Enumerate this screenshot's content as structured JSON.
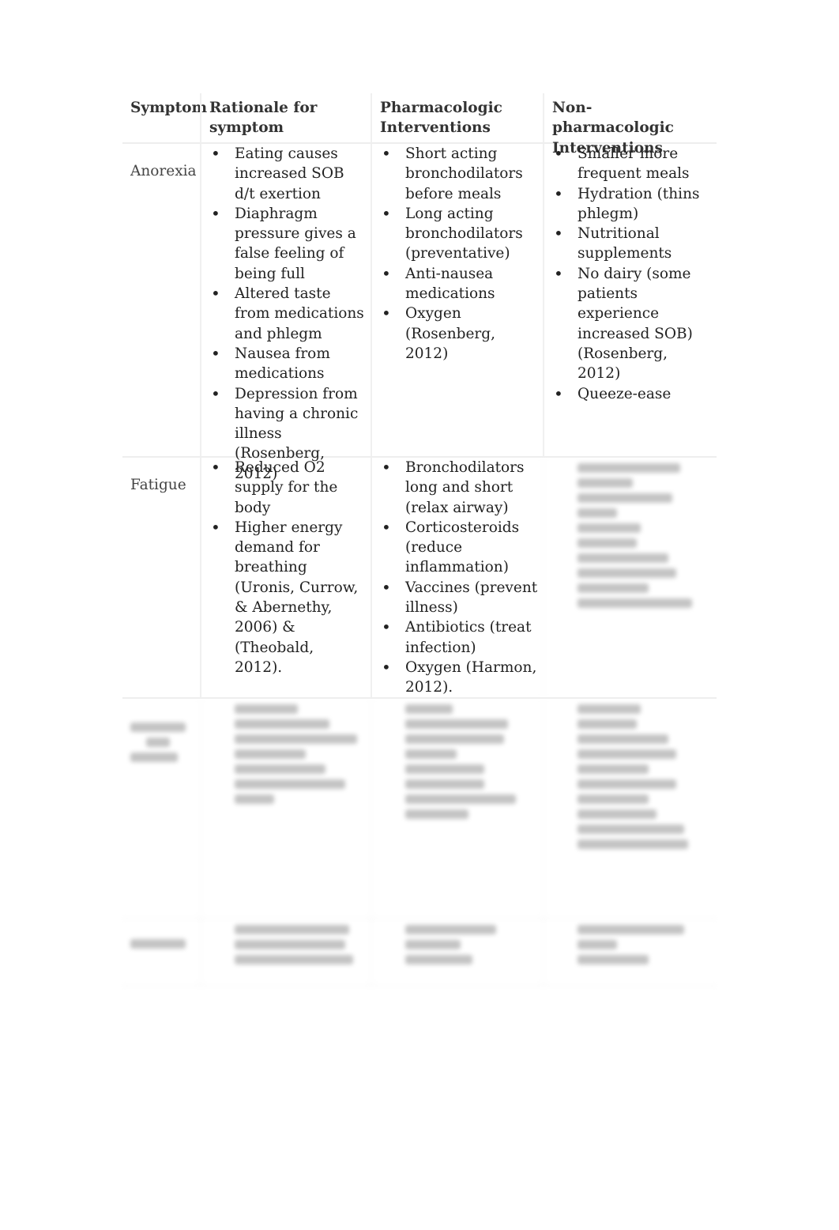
{
  "headers": [
    "Symptom",
    "Rationale for symptom",
    "Pharmacologic Interventions",
    "Non-pharmacologic Interventions"
  ],
  "rows": [
    {
      "symptom": "Anorexia",
      "rationale": [
        "Eating causes increased SOB d/t exertion",
        "Diaphragm pressure gives a false feeling of being full",
        "Altered taste from medications and phlegm",
        "Nausea from medications",
        "Depression from having a chronic illness (Rosenberg, 2012)"
      ],
      "pharm": [
        "Short acting bronchodilators before meals",
        "Long acting bronchodilators (preventative)",
        "Anti-nausea medications",
        "Oxygen (Rosenberg, 2012)"
      ],
      "nonpharm": [
        "Smaller more frequent meals",
        "Hydration (thins phlegm)",
        "Nutritional supplements",
        "No dairy (some patients experience increased SOB) (Rosenberg, 2012)",
        "Queeze-ease"
      ]
    },
    {
      "symptom": "Fatigue",
      "rationale": [
        "Reduced O2 supply for the body",
        "Higher energy demand for breathing (Uronis, Currow, & Abernethy, 2006) & (Theobald, 2012)."
      ],
      "pharm": [
        "Bronchodilators long and short (relax airway)",
        "Corticosteroids (reduce inflammation)",
        "Vaccines (prevent illness)",
        "Antibiotics (treat infection)",
        "Oxygen (Harmon, 2012)."
      ]
    }
  ]
}
